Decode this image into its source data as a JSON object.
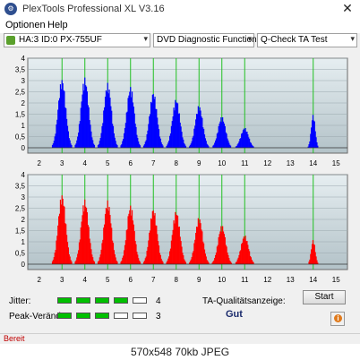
{
  "app": {
    "title": "PlexTools Professional XL V3.16",
    "close_glyph": "✕",
    "icon_glyph": "⚙"
  },
  "menu": {
    "items": [
      "Optionen",
      "Help"
    ]
  },
  "toolbar": {
    "drive": "HA:3 ID:0  PX-755UF",
    "function": "DVD Diagnostic Functions",
    "test": "Q-Check TA Test",
    "arrow_glyph": "▾"
  },
  "charts": {
    "y_ticks": [
      "4",
      "3,5",
      "3",
      "2,5",
      "2",
      "1,5",
      "1",
      "0,5",
      "0"
    ],
    "x_ticks": [
      "2",
      "3",
      "4",
      "5",
      "6",
      "7",
      "8",
      "9",
      "10",
      "11",
      "12",
      "13",
      "14",
      "15"
    ]
  },
  "chart_data": [
    {
      "type": "area",
      "title": "",
      "color": "#0000ff",
      "xlim": [
        1.5,
        15.5
      ],
      "ylim": [
        0,
        4
      ],
      "green_lines": [
        3,
        4,
        5,
        6,
        7,
        8,
        9,
        10,
        11,
        14
      ],
      "peaks": [
        {
          "x": 3,
          "y": 3.1
        },
        {
          "x": 4,
          "y": 3.15
        },
        {
          "x": 5,
          "y": 2.9
        },
        {
          "x": 6,
          "y": 2.75
        },
        {
          "x": 7,
          "y": 2.5
        },
        {
          "x": 8,
          "y": 2.2
        },
        {
          "x": 9,
          "y": 1.9
        },
        {
          "x": 10,
          "y": 1.4
        },
        {
          "x": 11,
          "y": 0.9
        },
        {
          "x": 14,
          "y": 1.5
        }
      ]
    },
    {
      "type": "area",
      "title": "",
      "color": "#ff0000",
      "xlim": [
        1.5,
        15.5
      ],
      "ylim": [
        0,
        4
      ],
      "green_lines": [
        3,
        4,
        5,
        6,
        7,
        8,
        9,
        10,
        11,
        14
      ],
      "peaks": [
        {
          "x": 3,
          "y": 3.15
        },
        {
          "x": 4,
          "y": 2.9
        },
        {
          "x": 5,
          "y": 2.85
        },
        {
          "x": 6,
          "y": 2.65
        },
        {
          "x": 7,
          "y": 2.5
        },
        {
          "x": 8,
          "y": 2.4
        },
        {
          "x": 9,
          "y": 2.1
        },
        {
          "x": 10,
          "y": 1.75
        },
        {
          "x": 11,
          "y": 1.3
        },
        {
          "x": 14,
          "y": 1.1
        }
      ]
    }
  ],
  "metrics": {
    "jitter_label": "Jitter:",
    "jitter_value": "4",
    "jitter_level": 4,
    "peak_label": "Peak-Veränd:",
    "peak_value": "3",
    "peak_level": 3,
    "segments": 5,
    "quality_label": "TA-Qualitätsanzeige:",
    "quality_value": "Gut",
    "start_label": "Start",
    "info_glyph": "i",
    "meter_on_color": "#00c000"
  },
  "status": {
    "text": "Bereit"
  },
  "caption": {
    "text": "570x548 70kb JPEG"
  }
}
